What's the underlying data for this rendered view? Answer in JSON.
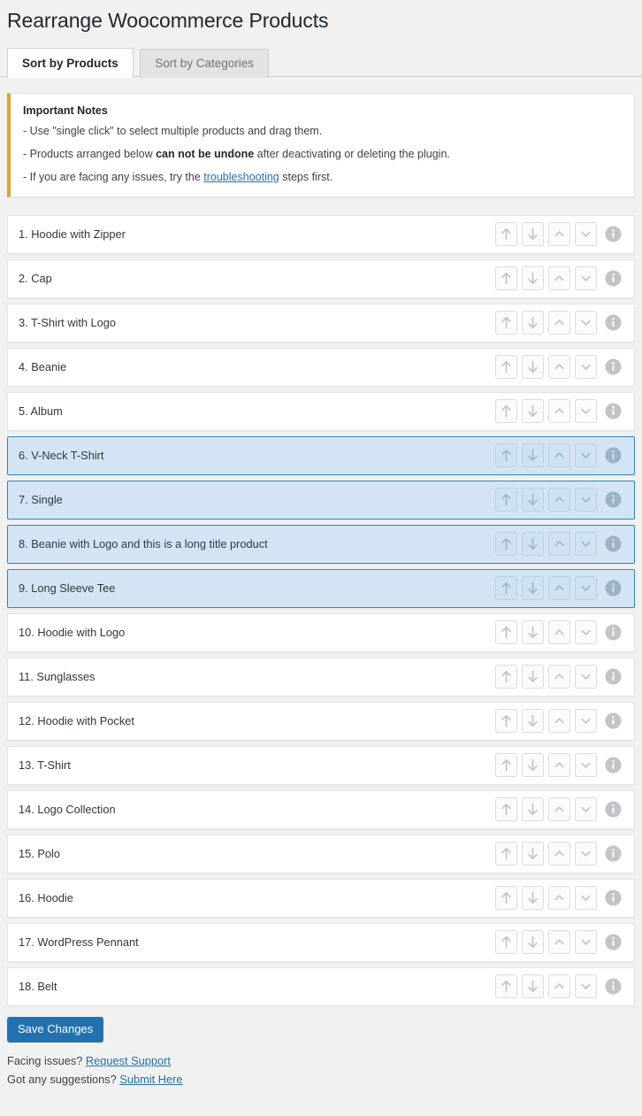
{
  "header": {
    "title": "Rearrange Woocommerce Products"
  },
  "tabs": [
    {
      "label": "Sort by Products",
      "active": true
    },
    {
      "label": "Sort by Categories",
      "active": false
    }
  ],
  "notes": {
    "title": "Important Notes",
    "line1": "- Use \"single click\" to select multiple products and drag them.",
    "line2_pre": "- Products arranged below ",
    "line2_bold": "can not be undone",
    "line2_post": " after deactivating or deleting the plugin.",
    "line3_pre": "- If you are facing any issues, try the ",
    "line3_link": "troubleshooting",
    "line3_post": " steps first.",
    "accent_color": "#e0a526"
  },
  "row_buttons": [
    {
      "name": "move-to-top-button",
      "icon": "arrow-up-icon"
    },
    {
      "name": "move-to-bottom-button",
      "icon": "arrow-down-icon"
    },
    {
      "name": "move-up-button",
      "icon": "chevron-up-icon"
    },
    {
      "name": "move-down-button",
      "icon": "chevron-down-icon"
    },
    {
      "name": "product-info-button",
      "icon": "info-icon"
    }
  ],
  "products": [
    {
      "label": "1. Hoodie with Zipper",
      "selected": false
    },
    {
      "label": "2. Cap",
      "selected": false
    },
    {
      "label": "3. T-Shirt with Logo",
      "selected": false
    },
    {
      "label": "4. Beanie",
      "selected": false
    },
    {
      "label": "5. Album",
      "selected": false
    },
    {
      "label": "6. V-Neck T-Shirt",
      "selected": true
    },
    {
      "label": "7. Single",
      "selected": true
    },
    {
      "label": "8. Beanie with Logo and this is a long title product",
      "selected": true
    },
    {
      "label": "9. Long Sleeve Tee",
      "selected": true
    },
    {
      "label": "10. Hoodie with Logo",
      "selected": false
    },
    {
      "label": "11. Sunglasses",
      "selected": false
    },
    {
      "label": "12. Hoodie with Pocket",
      "selected": false
    },
    {
      "label": "13. T-Shirt",
      "selected": false
    },
    {
      "label": "14. Logo Collection",
      "selected": false
    },
    {
      "label": "15. Polo",
      "selected": false
    },
    {
      "label": "16. Hoodie",
      "selected": false
    },
    {
      "label": "17. WordPress Pennant",
      "selected": false
    },
    {
      "label": "18. Belt",
      "selected": false
    }
  ],
  "footer": {
    "save_label": "Save Changes",
    "support_prefix": "Facing issues? ",
    "support_link": "Request Support",
    "suggestion_prefix": "Got any suggestions? ",
    "suggestion_link": "Submit Here"
  },
  "colors": {
    "accent_blue": "#2271b1",
    "selected_row_bg": "#d3e5f5",
    "selected_row_border": "#2e87c4",
    "notes_accent": "#e0a526",
    "page_bg": "#f1f1f1"
  }
}
